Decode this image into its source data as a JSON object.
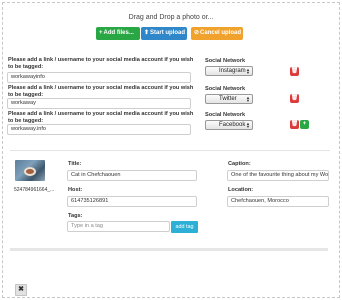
{
  "header": {
    "title": "Drag and Drop a photo or..."
  },
  "toolbar": {
    "add_files": {
      "glyph": "+",
      "label": "Add files..."
    },
    "start_upload": {
      "glyph": "⬆",
      "label": "Start upload"
    },
    "cancel_upload": {
      "glyph": "⊘",
      "label": "Cancel upload"
    }
  },
  "social_rows": [
    {
      "prompt": "Please add a link / username to your social media account if you wish to be tagged:",
      "value": "workawayinfo",
      "network_label": "Social Network",
      "network": "Instagram"
    },
    {
      "prompt": "Please add a link / username to your social media account if you wish to be tagged:",
      "value": "workaway",
      "network_label": "Social Network",
      "network": "Twitter"
    },
    {
      "prompt": "Please add a link / username to your social media account if you wish to be tagged:",
      "value": "workaway.info",
      "network_label": "Social Network",
      "network": "Facebook"
    }
  ],
  "icons": {
    "trash": "🗑",
    "plus": "+",
    "caret": "▲▼",
    "close": "✖"
  },
  "photo": {
    "filename": "524784961664_...",
    "title_label": "Title:",
    "title_value": "Cat in Chefchaouen",
    "caption_label": "Caption:",
    "caption_value": "One of the favourite thing about my Workaway in Che",
    "host_label": "Host:",
    "host_value": "6147351268​91",
    "location_label": "Location:",
    "location_value": "Chefchaouen, Morocco",
    "tags_label": "Tags:",
    "tags_placeholder": "Type in a tag",
    "add_tag_label": "add tag"
  },
  "colors": {
    "green": "#29a745",
    "blue": "#2f86c8",
    "orange": "#f0a22c",
    "red": "#dc3b3b",
    "cyan": "#2eb0d6"
  }
}
